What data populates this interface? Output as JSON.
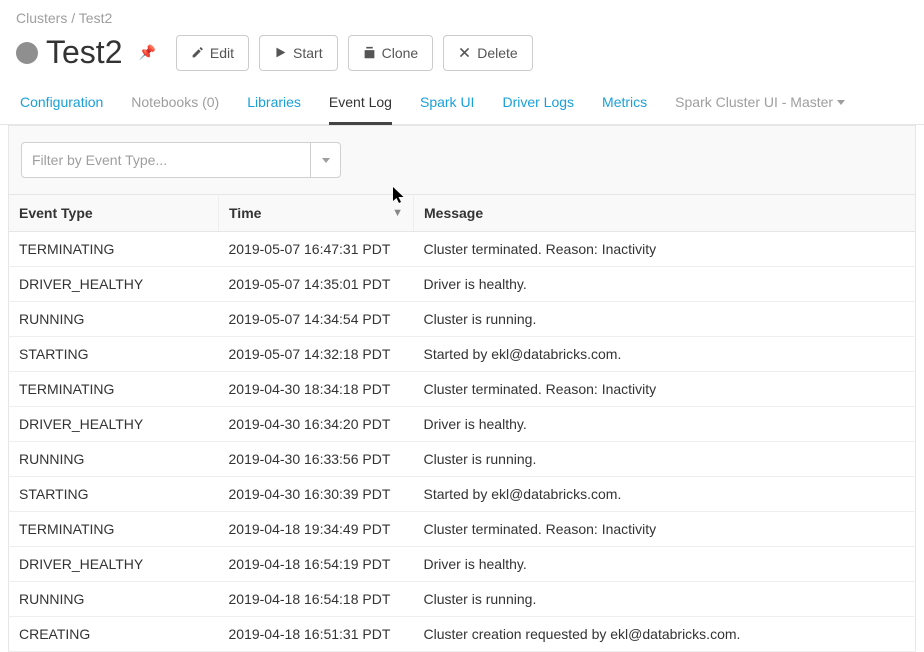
{
  "breadcrumb": {
    "parent": "Clusters",
    "current": "Test2"
  },
  "cluster": {
    "name": "Test2"
  },
  "buttons": {
    "edit": "Edit",
    "start": "Start",
    "clone": "Clone",
    "delete": "Delete"
  },
  "tabs": {
    "configuration": "Configuration",
    "notebooks": "Notebooks (0)",
    "libraries": "Libraries",
    "event_log": "Event Log",
    "spark_ui": "Spark UI",
    "driver_logs": "Driver Logs",
    "metrics": "Metrics",
    "spark_cluster_ui": "Spark Cluster UI - Master"
  },
  "filter": {
    "placeholder": "Filter by Event Type..."
  },
  "table": {
    "headers": {
      "event_type": "Event Type",
      "time": "Time",
      "message": "Message"
    },
    "rows": [
      {
        "event_type": "TERMINATING",
        "time": "2019-05-07 16:47:31 PDT",
        "message": "Cluster terminated. Reason: Inactivity"
      },
      {
        "event_type": "DRIVER_HEALTHY",
        "time": "2019-05-07 14:35:01 PDT",
        "message": "Driver is healthy."
      },
      {
        "event_type": "RUNNING",
        "time": "2019-05-07 14:34:54 PDT",
        "message": "Cluster is running."
      },
      {
        "event_type": "STARTING",
        "time": "2019-05-07 14:32:18 PDT",
        "message": "Started by ekl@databricks.com."
      },
      {
        "event_type": "TERMINATING",
        "time": "2019-04-30 18:34:18 PDT",
        "message": "Cluster terminated. Reason: Inactivity"
      },
      {
        "event_type": "DRIVER_HEALTHY",
        "time": "2019-04-30 16:34:20 PDT",
        "message": "Driver is healthy."
      },
      {
        "event_type": "RUNNING",
        "time": "2019-04-30 16:33:56 PDT",
        "message": "Cluster is running."
      },
      {
        "event_type": "STARTING",
        "time": "2019-04-30 16:30:39 PDT",
        "message": "Started by ekl@databricks.com."
      },
      {
        "event_type": "TERMINATING",
        "time": "2019-04-18 19:34:49 PDT",
        "message": "Cluster terminated. Reason: Inactivity"
      },
      {
        "event_type": "DRIVER_HEALTHY",
        "time": "2019-04-18 16:54:19 PDT",
        "message": "Driver is healthy."
      },
      {
        "event_type": "RUNNING",
        "time": "2019-04-18 16:54:18 PDT",
        "message": "Cluster is running."
      },
      {
        "event_type": "CREATING",
        "time": "2019-04-18 16:51:31 PDT",
        "message": "Cluster creation requested by ekl@databricks.com."
      }
    ]
  }
}
